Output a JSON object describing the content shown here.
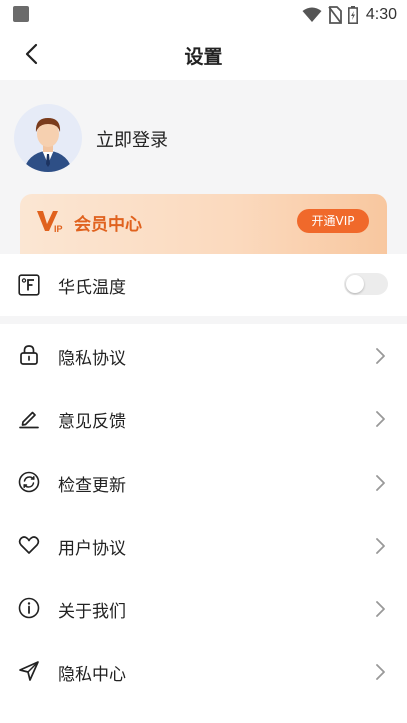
{
  "status_bar": {
    "time": "4:30"
  },
  "header": {
    "title": "设置"
  },
  "profile": {
    "login_label": "立即登录"
  },
  "vip": {
    "title": "会员中心",
    "button_label": "开通VIP",
    "accent": "#f0692b"
  },
  "temperature": {
    "label": "华氏温度",
    "icon": "fahrenheit-icon",
    "enabled": false
  },
  "menu": {
    "items": [
      {
        "label": "隐私协议",
        "icon": "lock-icon"
      },
      {
        "label": "意见反馈",
        "icon": "pencil-icon"
      },
      {
        "label": "检查更新",
        "icon": "refresh-icon"
      },
      {
        "label": "用户协议",
        "icon": "heart-icon"
      },
      {
        "label": "关于我们",
        "icon": "info-icon"
      },
      {
        "label": "隐私中心",
        "icon": "send-icon"
      }
    ]
  }
}
